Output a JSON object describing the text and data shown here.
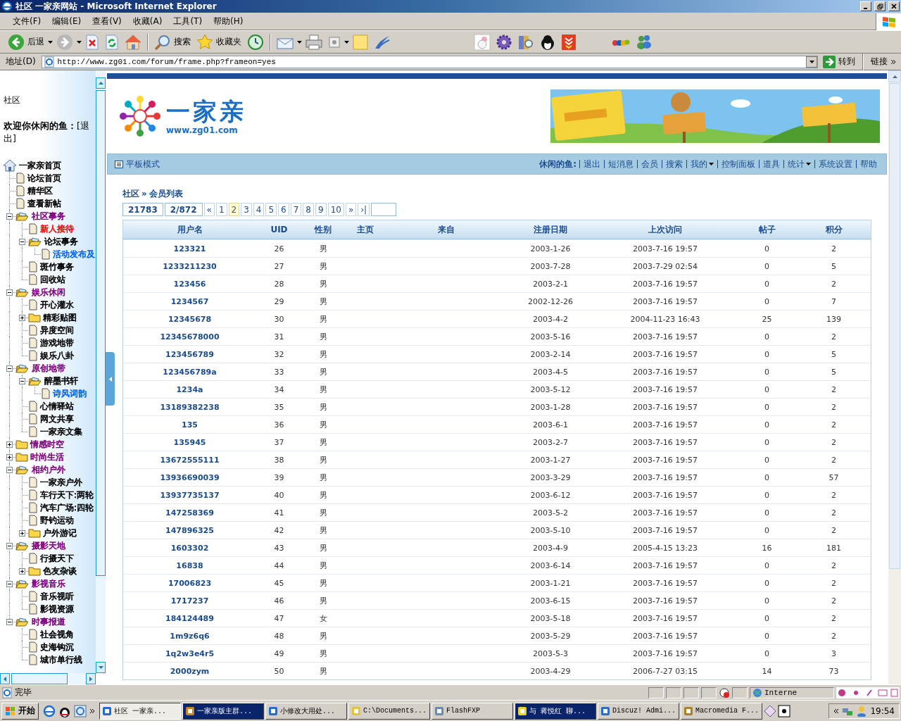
{
  "window": {
    "title": "社区 一家亲网站 - Microsoft Internet Explorer"
  },
  "menu": [
    "文件(F)",
    "编辑(E)",
    "查看(V)",
    "收藏(A)",
    "工具(T)",
    "帮助(H)"
  ],
  "toolbar": {
    "back": "后退",
    "search": "搜索",
    "favorites": "收藏夹"
  },
  "address": {
    "label": "地址(D)",
    "url": "http://www.zg01.com/forum/frame.php?frameon=yes",
    "go": "转到",
    "links": "链接"
  },
  "sidebar": {
    "title": "社区",
    "welcome": "**欢迎你休闲的鱼：**[退出]",
    "tree": {
      "label": "一家亲首页",
      "kind": "home",
      "color": "#000000",
      "children": [
        {
          "label": "论坛首页",
          "kind": "page",
          "color": "#000000"
        },
        {
          "label": "精华区",
          "kind": "page",
          "color": "#000000"
        },
        {
          "label": "查看新帖",
          "kind": "page",
          "color": "#000000"
        },
        {
          "label": "社区事务",
          "kind": "folder",
          "expanded": true,
          "color": "#800080",
          "children": [
            {
              "label": "新人接待",
              "kind": "page",
              "color": "#ff0000"
            },
            {
              "label": "论坛事务",
              "kind": "folder",
              "expanded": true,
              "color": "#000000",
              "children": [
                {
                  "label": "活动发布及",
                  "kind": "page",
                  "color": "#0066ff"
                }
              ]
            },
            {
              "label": "斑竹事务",
              "kind": "page",
              "color": "#000000"
            },
            {
              "label": "回收站",
              "kind": "page",
              "color": "#000000"
            }
          ]
        },
        {
          "label": "娱乐休闲",
          "kind": "folder",
          "expanded": true,
          "color": "#800080",
          "children": [
            {
              "label": "开心灌水",
              "kind": "page",
              "color": "#000000"
            },
            {
              "label": "精彩贴图",
              "kind": "folder",
              "expanded": false,
              "color": "#000000"
            },
            {
              "label": "异度空间",
              "kind": "page",
              "color": "#000000"
            },
            {
              "label": "游戏地带",
              "kind": "page",
              "color": "#000000"
            },
            {
              "label": "娱乐八卦",
              "kind": "page",
              "color": "#000000"
            }
          ]
        },
        {
          "label": "原创地带",
          "kind": "folder",
          "expanded": true,
          "color": "#800080",
          "children": [
            {
              "label": "醉墨书轩",
              "kind": "folder",
              "expanded": true,
              "color": "#000000",
              "children": [
                {
                  "label": "诗风词韵",
                  "kind": "page",
                  "color": "#0066ff"
                }
              ]
            },
            {
              "label": "心情驿站",
              "kind": "page",
              "color": "#000000"
            },
            {
              "label": "网文共享",
              "kind": "page",
              "color": "#000000"
            },
            {
              "label": "一家亲文集",
              "kind": "page",
              "color": "#000000"
            }
          ]
        },
        {
          "label": "情感时空",
          "kind": "folder",
          "expanded": false,
          "color": "#800080"
        },
        {
          "label": "时尚生活",
          "kind": "folder",
          "expanded": false,
          "color": "#800080"
        },
        {
          "label": "相约户外",
          "kind": "folder",
          "expanded": true,
          "color": "#800080",
          "children": [
            {
              "label": "一家亲户外",
              "kind": "page",
              "color": "#000000"
            },
            {
              "label": "车行天下:两轮",
              "kind": "page",
              "color": "#000000"
            },
            {
              "label": "汽车广场:四轮",
              "kind": "page",
              "color": "#000000"
            },
            {
              "label": "野钓运动",
              "kind": "page",
              "color": "#000000"
            },
            {
              "label": "户外游记",
              "kind": "folder",
              "expanded": false,
              "color": "#000000"
            }
          ]
        },
        {
          "label": "摄影天地",
          "kind": "folder",
          "expanded": true,
          "color": "#800080",
          "children": [
            {
              "label": "行摄天下",
              "kind": "page",
              "color": "#000000"
            },
            {
              "label": "色友杂谈",
              "kind": "folder",
              "expanded": false,
              "color": "#000000"
            }
          ]
        },
        {
          "label": "影视音乐",
          "kind": "folder",
          "expanded": true,
          "color": "#800080",
          "children": [
            {
              "label": "音乐视听",
              "kind": "page",
              "color": "#000000"
            },
            {
              "label": "影视资源",
              "kind": "page",
              "color": "#000000"
            }
          ]
        },
        {
          "label": "时事报道",
          "kind": "folder",
          "expanded": true,
          "color": "#800080",
          "children": [
            {
              "label": "社会视角",
              "kind": "page",
              "color": "#000000"
            },
            {
              "label": "史海钩沉",
              "kind": "page",
              "color": "#000000"
            },
            {
              "label": "城市单行线",
              "kind": "page",
              "color": "#000000"
            }
          ]
        }
      ]
    }
  },
  "header": {
    "logo": "一家亲",
    "url": "www.zg01.com"
  },
  "nav": {
    "mode": "平板模式",
    "user": "休闲的鱼:",
    "links": [
      {
        "label": "退出",
        "dropdown": false
      },
      {
        "label": "短消息",
        "dropdown": false
      },
      {
        "label": "会员",
        "dropdown": false
      },
      {
        "label": "搜索",
        "dropdown": false
      },
      {
        "label": "我的",
        "dropdown": true
      },
      {
        "label": "控制面板",
        "dropdown": false
      },
      {
        "label": "道具",
        "dropdown": false
      },
      {
        "label": "统计",
        "dropdown": true
      },
      {
        "label": "系统设置",
        "dropdown": false
      },
      {
        "label": "帮助",
        "dropdown": false
      }
    ]
  },
  "breadcrumb": {
    "items": [
      "社区",
      "会员列表"
    ],
    "separator": "»"
  },
  "pager": {
    "total": "21783",
    "position": "2/872",
    "first": "«",
    "pages": [
      {
        "label": "1",
        "selected": false
      },
      {
        "label": "2",
        "selected": true
      },
      {
        "label": "3",
        "selected": false
      },
      {
        "label": "4",
        "selected": false
      },
      {
        "label": "5",
        "selected": false
      },
      {
        "label": "6",
        "selected": false
      },
      {
        "label": "7",
        "selected": false
      },
      {
        "label": "8",
        "selected": false
      },
      {
        "label": "9",
        "selected": false
      },
      {
        "label": "10",
        "selected": false
      }
    ],
    "next": "»",
    "last": "›|"
  },
  "table": {
    "columns": [
      "用户名",
      "UID",
      "性别",
      "主页",
      "来自",
      "注册日期",
      "上次访问",
      "帖子",
      "积分"
    ],
    "rows": [
      {
        "name": "123321",
        "uid": "26",
        "gender": "男",
        "registered": "2003-1-26",
        "last_visit": "2003-7-16 19:57",
        "posts": "0",
        "points": "2"
      },
      {
        "name": "1233211230",
        "uid": "27",
        "gender": "男",
        "registered": "2003-7-28",
        "last_visit": "2003-7-29 02:54",
        "posts": "0",
        "points": "5"
      },
      {
        "name": "123456",
        "uid": "28",
        "gender": "男",
        "registered": "2003-2-1",
        "last_visit": "2003-7-16 19:57",
        "posts": "0",
        "points": "2"
      },
      {
        "name": "1234567",
        "uid": "29",
        "gender": "男",
        "registered": "2002-12-26",
        "last_visit": "2003-7-16 19:57",
        "posts": "0",
        "points": "7"
      },
      {
        "name": "12345678",
        "uid": "30",
        "gender": "男",
        "registered": "2003-4-2",
        "last_visit": "2004-11-23 16:43",
        "posts": "25",
        "points": "139"
      },
      {
        "name": "12345678000",
        "uid": "31",
        "gender": "男",
        "registered": "2003-5-16",
        "last_visit": "2003-7-16 19:57",
        "posts": "0",
        "points": "2"
      },
      {
        "name": "123456789",
        "uid": "32",
        "gender": "男",
        "registered": "2003-2-14",
        "last_visit": "2003-7-16 19:57",
        "posts": "0",
        "points": "5"
      },
      {
        "name": "123456789a",
        "uid": "33",
        "gender": "男",
        "registered": "2003-4-5",
        "last_visit": "2003-7-16 19:57",
        "posts": "0",
        "points": "5"
      },
      {
        "name": "1234a",
        "uid": "34",
        "gender": "男",
        "registered": "2003-5-12",
        "last_visit": "2003-7-16 19:57",
        "posts": "0",
        "points": "2"
      },
      {
        "name": "13189382238",
        "uid": "35",
        "gender": "男",
        "registered": "2003-1-28",
        "last_visit": "2003-7-16 19:57",
        "posts": "0",
        "points": "2"
      },
      {
        "name": "135",
        "uid": "36",
        "gender": "男",
        "registered": "2003-6-1",
        "last_visit": "2003-7-16 19:57",
        "posts": "0",
        "points": "2"
      },
      {
        "name": "135945",
        "uid": "37",
        "gender": "男",
        "registered": "2003-2-7",
        "last_visit": "2003-7-16 19:57",
        "posts": "0",
        "points": "2"
      },
      {
        "name": "13672555111",
        "uid": "38",
        "gender": "男",
        "registered": "2003-1-27",
        "last_visit": "2003-7-16 19:57",
        "posts": "0",
        "points": "2"
      },
      {
        "name": "13936690039",
        "uid": "39",
        "gender": "男",
        "registered": "2003-3-29",
        "last_visit": "2003-7-16 19:57",
        "posts": "0",
        "points": "57"
      },
      {
        "name": "13937735137",
        "uid": "40",
        "gender": "男",
        "registered": "2003-6-12",
        "last_visit": "2003-7-16 19:57",
        "posts": "0",
        "points": "2"
      },
      {
        "name": "147258369",
        "uid": "41",
        "gender": "男",
        "registered": "2003-5-2",
        "last_visit": "2003-7-16 19:57",
        "posts": "0",
        "points": "2"
      },
      {
        "name": "147896325",
        "uid": "42",
        "gender": "男",
        "registered": "2003-5-10",
        "last_visit": "2003-7-16 19:57",
        "posts": "0",
        "points": "2"
      },
      {
        "name": "1603302",
        "uid": "43",
        "gender": "男",
        "registered": "2003-4-9",
        "last_visit": "2005-4-15 13:23",
        "posts": "16",
        "points": "181"
      },
      {
        "name": "16838",
        "uid": "44",
        "gender": "男",
        "registered": "2003-6-14",
        "last_visit": "2003-7-16 19:57",
        "posts": "0",
        "points": "2"
      },
      {
        "name": "17006823",
        "uid": "45",
        "gender": "男",
        "registered": "2003-1-21",
        "last_visit": "2003-7-16 19:57",
        "posts": "0",
        "points": "2"
      },
      {
        "name": "1717237",
        "uid": "46",
        "gender": "男",
        "registered": "2003-6-15",
        "last_visit": "2003-7-16 19:57",
        "posts": "0",
        "points": "2"
      },
      {
        "name": "184124489",
        "uid": "47",
        "gender": "女",
        "registered": "2003-5-18",
        "last_visit": "2003-7-16 19:57",
        "posts": "0",
        "points": "2"
      },
      {
        "name": "1m9z6q6",
        "uid": "48",
        "gender": "男",
        "registered": "2003-5-29",
        "last_visit": "2003-7-16 19:57",
        "posts": "0",
        "points": "2"
      },
      {
        "name": "1q2w3e4r5",
        "uid": "49",
        "gender": "男",
        "registered": "2003-5-3",
        "last_visit": "2003-7-16 19:57",
        "posts": "0",
        "points": "3"
      },
      {
        "name": "2000zym",
        "uid": "50",
        "gender": "男",
        "registered": "2003-4-29",
        "last_visit": "2006-7-27 03:15",
        "posts": "14",
        "points": "73"
      }
    ]
  },
  "status_bar": {
    "text": "完毕",
    "zone": "Interne"
  },
  "taskbar": {
    "start": "开始",
    "tasks": [
      {
        "label": "社区 一家亲...",
        "selected": true,
        "flashing": false
      },
      {
        "label": "一家亲版主群...",
        "selected": false,
        "flashing": true
      },
      {
        "label": "小修改大用处...",
        "selected": false,
        "flashing": false
      },
      {
        "label": "C:\\Documents...",
        "selected": false,
        "flashing": false
      },
      {
        "label": "FlashFXP",
        "selected": false,
        "flashing": false
      },
      {
        "label": "与 蒋悦红 聊...",
        "selected": false,
        "flashing": true
      },
      {
        "label": "Discuz! Admi...",
        "selected": false,
        "flashing": false
      },
      {
        "label": "Macromedia F...",
        "selected": false,
        "flashing": false
      }
    ],
    "clock": "19:54"
  }
}
